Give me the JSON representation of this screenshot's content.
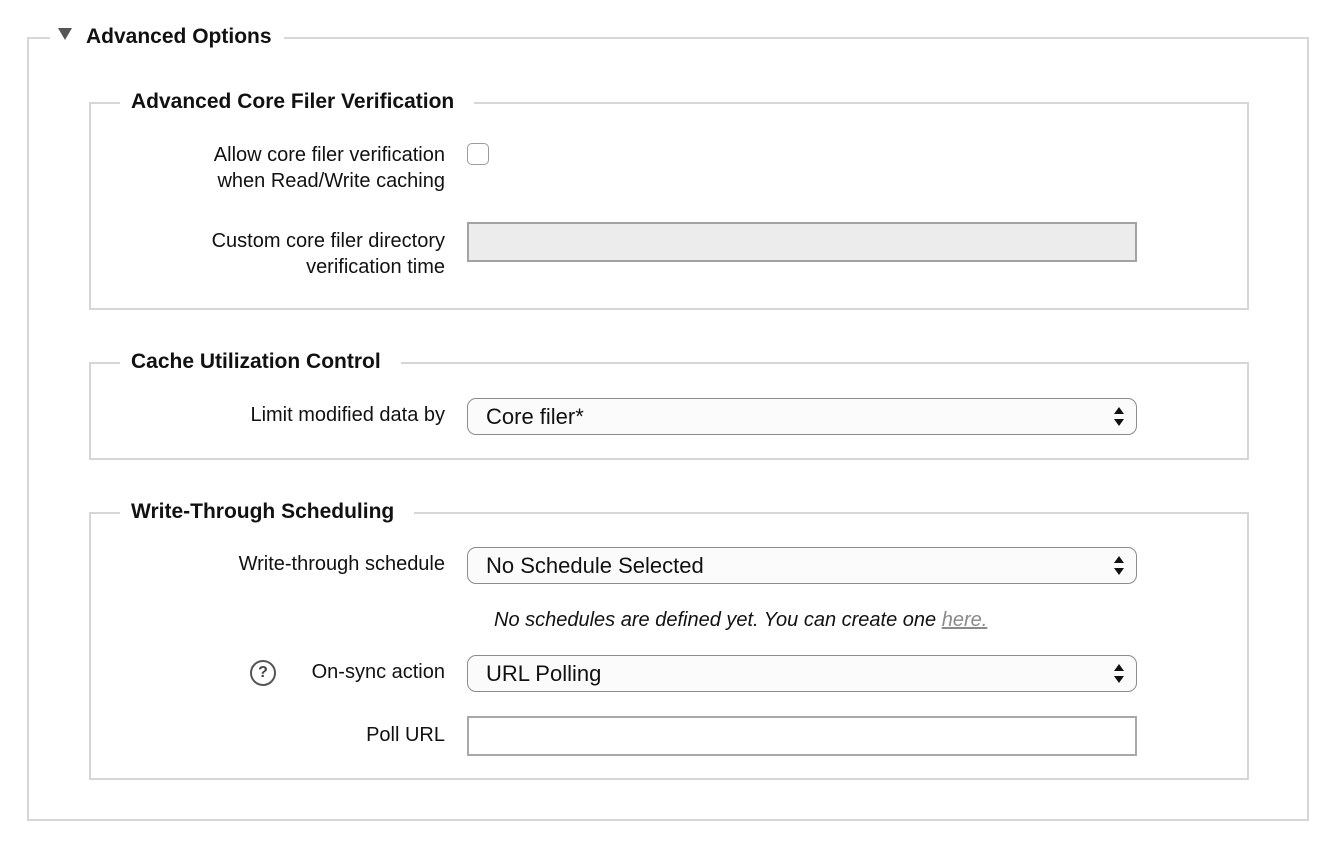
{
  "panel": {
    "title": "Advanced Options",
    "toggle_icon": "triangle-down-icon"
  },
  "groups": {
    "verification": {
      "title": "Advanced Core Filer Verification",
      "allow_label_line1": "Allow core filer verification",
      "allow_label_line2": "when Read/Write caching",
      "allow_checked": false,
      "custom_label_line1": "Custom core filer directory",
      "custom_label_line2": "verification time",
      "custom_value": ""
    },
    "cache": {
      "title": "Cache Utilization Control",
      "limit_label": "Limit modified data by",
      "limit_value": "Core filer*"
    },
    "writethrough": {
      "title": "Write-Through Scheduling",
      "schedule_label": "Write-through schedule",
      "schedule_value": "No Schedule Selected",
      "hint_text": "No schedules are defined yet. You can create one ",
      "hint_link": "here.",
      "onsync_label": "On-sync action",
      "onsync_value": "URL Polling",
      "help_glyph": "?",
      "poll_label": "Poll URL",
      "poll_value": ""
    }
  }
}
